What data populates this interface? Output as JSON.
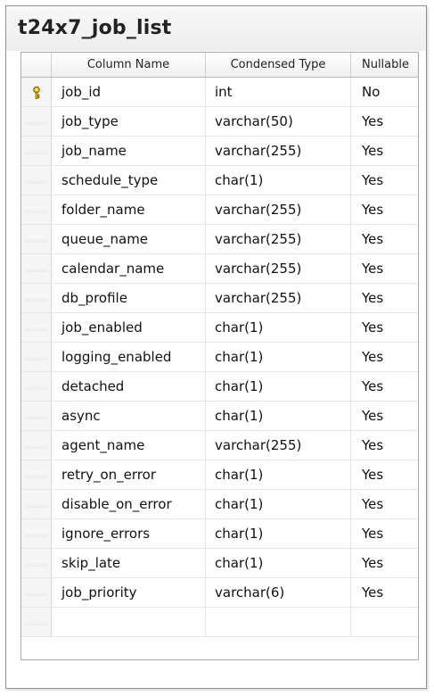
{
  "window": {
    "title": "t24x7_job_list"
  },
  "columns": {
    "name": "Column Name",
    "type": "Condensed Type",
    "nullable": "Nullable"
  },
  "rows": [
    {
      "name": "job_id",
      "type": "int",
      "nullable": "No",
      "primary_key": true
    },
    {
      "name": "job_type",
      "type": "varchar(50)",
      "nullable": "Yes"
    },
    {
      "name": "job_name",
      "type": "varchar(255)",
      "nullable": "Yes"
    },
    {
      "name": "schedule_type",
      "type": "char(1)",
      "nullable": "Yes"
    },
    {
      "name": "folder_name",
      "type": "varchar(255)",
      "nullable": "Yes"
    },
    {
      "name": "queue_name",
      "type": "varchar(255)",
      "nullable": "Yes"
    },
    {
      "name": "calendar_name",
      "type": "varchar(255)",
      "nullable": "Yes"
    },
    {
      "name": "db_profile",
      "type": "varchar(255)",
      "nullable": "Yes"
    },
    {
      "name": "job_enabled",
      "type": "char(1)",
      "nullable": "Yes"
    },
    {
      "name": "logging_enabled",
      "type": "char(1)",
      "nullable": "Yes"
    },
    {
      "name": "detached",
      "type": "char(1)",
      "nullable": "Yes"
    },
    {
      "name": "async",
      "type": "char(1)",
      "nullable": "Yes"
    },
    {
      "name": "agent_name",
      "type": "varchar(255)",
      "nullable": "Yes"
    },
    {
      "name": "retry_on_error",
      "type": "char(1)",
      "nullable": "Yes"
    },
    {
      "name": "disable_on_error",
      "type": "char(1)",
      "nullable": "Yes"
    },
    {
      "name": "ignore_errors",
      "type": "char(1)",
      "nullable": "Yes"
    },
    {
      "name": "skip_late",
      "type": "char(1)",
      "nullable": "Yes"
    },
    {
      "name": "job_priority",
      "type": "varchar(6)",
      "nullable": "Yes"
    },
    {
      "name": "",
      "type": "",
      "nullable": ""
    }
  ],
  "icons": {
    "primary_key": "key-icon"
  },
  "colors": {
    "key_fill": "#e6c200",
    "border": "#a9a9a9"
  }
}
